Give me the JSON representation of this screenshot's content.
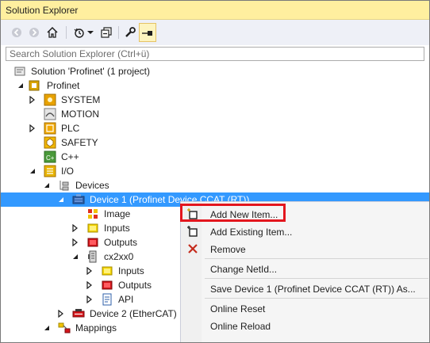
{
  "window": {
    "title": "Solution Explorer"
  },
  "toolbar": {
    "icons": [
      "back-arrow-icon",
      "forward-arrow-icon",
      "home-icon",
      "history-icon",
      "dropdown-icon",
      "collapse-all-icon",
      "wrench-icon",
      "pin-icon"
    ]
  },
  "search": {
    "placeholder": "Search Solution Explorer (Ctrl+ü)"
  },
  "tree": {
    "solution": "Solution 'Profinet' (1 project)",
    "project": "Profinet",
    "system": "SYSTEM",
    "motion": "MOTION",
    "plc": "PLC",
    "safety": "SAFETY",
    "cpp": "C++",
    "io": "I/O",
    "devices": "Devices",
    "device1": "Device 1 (Profinet Device CCAT (RT))",
    "image": "Image",
    "inputs": "Inputs",
    "outputs": "Outputs",
    "cx2xx0": "cx2xx0",
    "cx_inputs": "Inputs",
    "cx_outputs": "Outputs",
    "api": "API",
    "device2": "Device 2 (EtherCAT)",
    "mappings": "Mappings"
  },
  "context_menu": {
    "add_new_item": "Add New Item...",
    "add_existing_item": "Add Existing Item...",
    "remove": "Remove",
    "change_netid": "Change NetId...",
    "save_device": "Save Device 1 (Profinet Device CCAT (RT)) As...",
    "online_reset": "Online Reset",
    "online_reload": "Online Reload"
  },
  "colors": {
    "title_bar": "#ffef9f",
    "selection": "#3399ff",
    "highlight_box": "#e3161e"
  }
}
